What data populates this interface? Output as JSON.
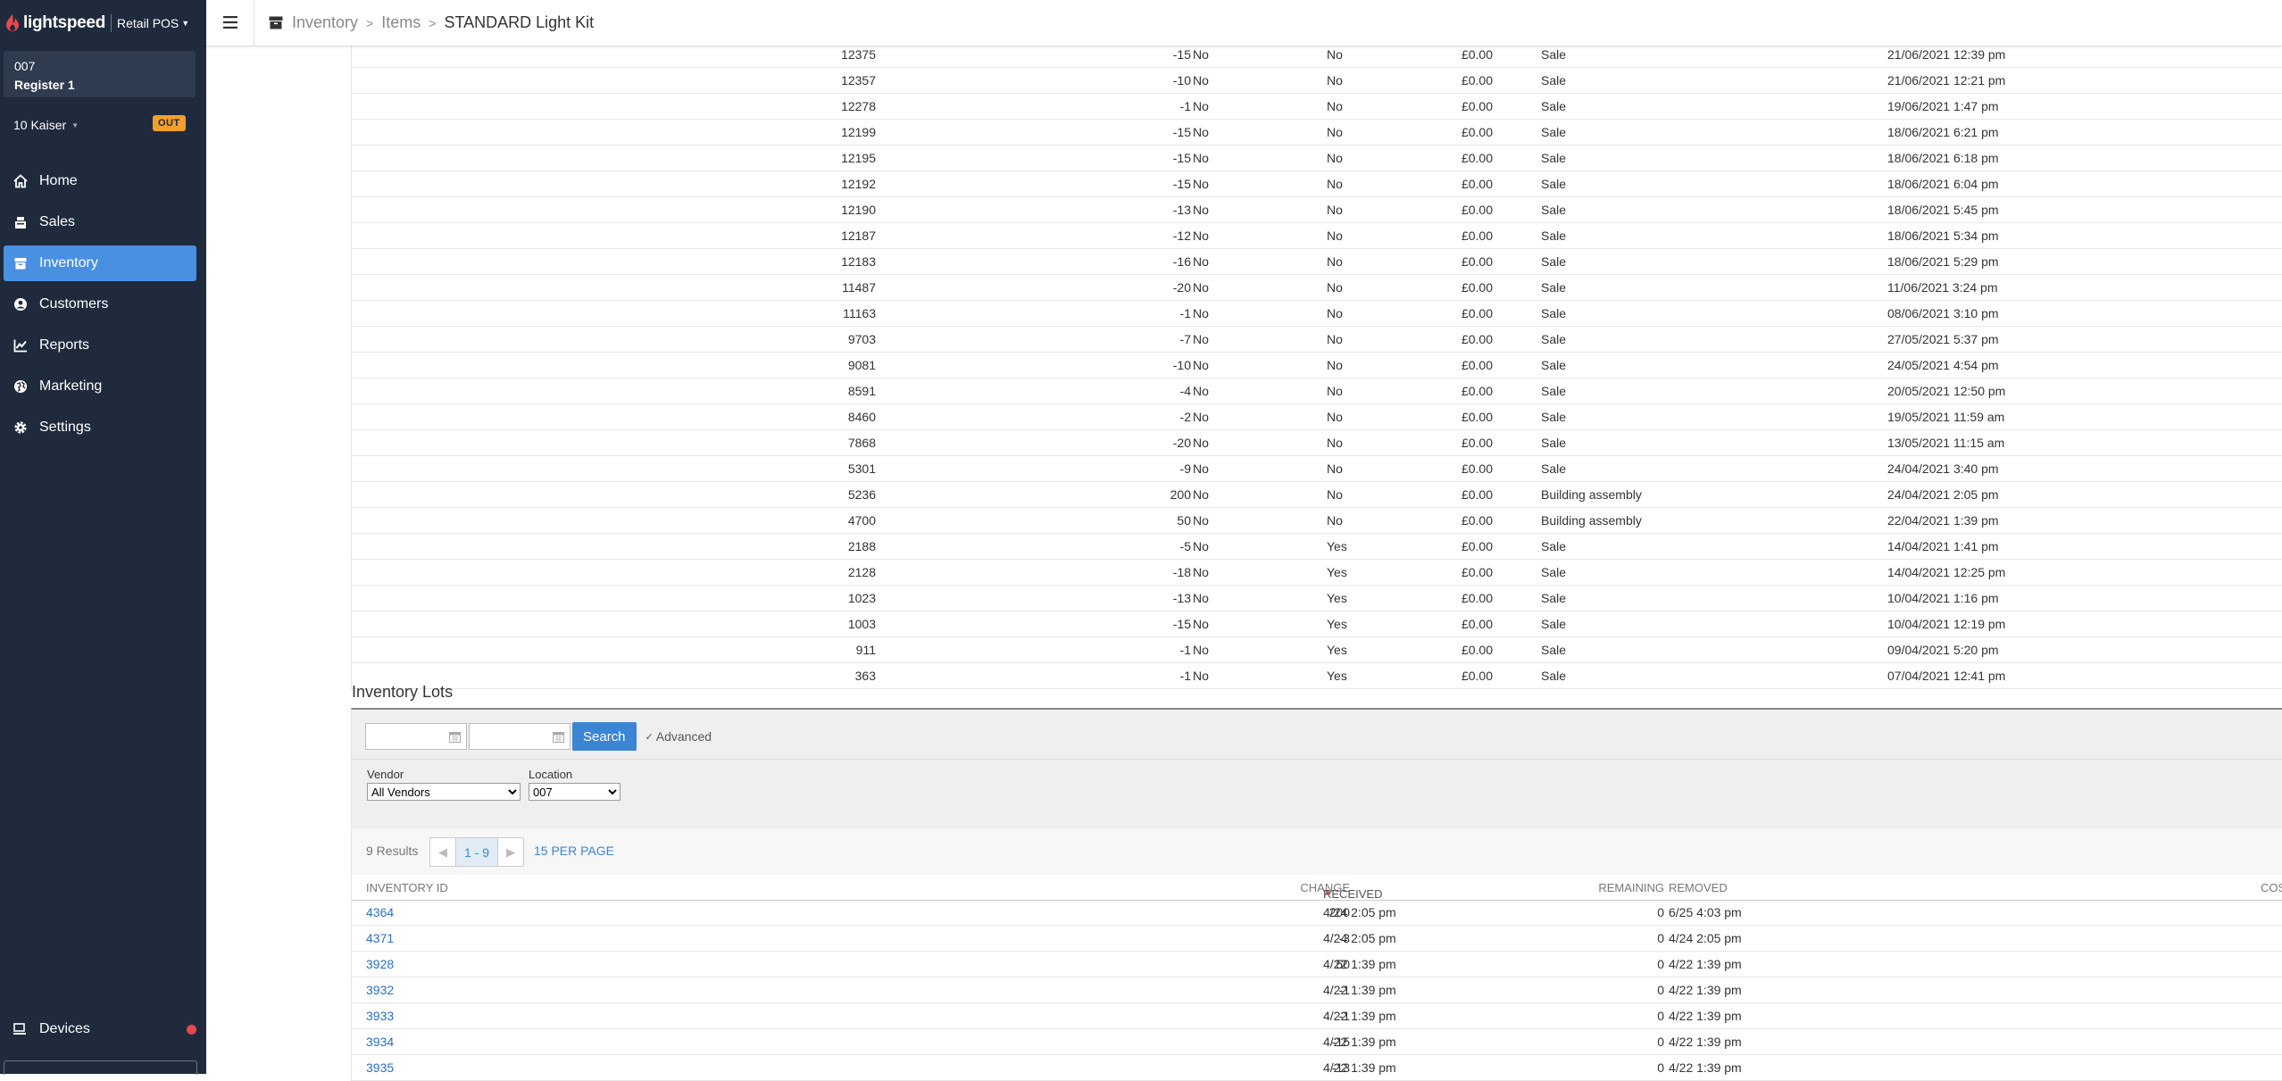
{
  "brand": {
    "name": "lightspeed",
    "product": "Retail POS"
  },
  "register": {
    "code": "007",
    "name": "Register 1"
  },
  "user": {
    "name": "10 Kaiser",
    "status_badge": "OUT"
  },
  "nav": [
    {
      "label": "Home",
      "icon": "home-icon"
    },
    {
      "label": "Sales",
      "icon": "sales-icon"
    },
    {
      "label": "Inventory",
      "icon": "inventory-icon",
      "active": true
    },
    {
      "label": "Customers",
      "icon": "customers-icon"
    },
    {
      "label": "Reports",
      "icon": "reports-icon"
    },
    {
      "label": "Marketing",
      "icon": "marketing-icon"
    },
    {
      "label": "Settings",
      "icon": "settings-icon"
    }
  ],
  "devices": {
    "label": "Devices"
  },
  "breadcrumb": {
    "items": [
      "Inventory",
      "Items",
      "STANDARD Light Kit"
    ]
  },
  "history": {
    "rows": [
      {
        "id": "12375",
        "change": "-15",
        "cost": "£0.00",
        "a": "No",
        "b": "No",
        "type": "Sale",
        "date": "21/06/2021 12:39 pm"
      },
      {
        "id": "12357",
        "change": "-10",
        "cost": "£0.00",
        "a": "No",
        "b": "No",
        "type": "Sale",
        "date": "21/06/2021 12:21 pm"
      },
      {
        "id": "12278",
        "change": "-1",
        "cost": "£0.00",
        "a": "No",
        "b": "No",
        "type": "Sale",
        "date": "19/06/2021 1:47 pm"
      },
      {
        "id": "12199",
        "change": "-15",
        "cost": "£0.00",
        "a": "No",
        "b": "No",
        "type": "Sale",
        "date": "18/06/2021 6:21 pm"
      },
      {
        "id": "12195",
        "change": "-15",
        "cost": "£0.00",
        "a": "No",
        "b": "No",
        "type": "Sale",
        "date": "18/06/2021 6:18 pm"
      },
      {
        "id": "12192",
        "change": "-15",
        "cost": "£0.00",
        "a": "No",
        "b": "No",
        "type": "Sale",
        "date": "18/06/2021 6:04 pm"
      },
      {
        "id": "12190",
        "change": "-13",
        "cost": "£0.00",
        "a": "No",
        "b": "No",
        "type": "Sale",
        "date": "18/06/2021 5:45 pm"
      },
      {
        "id": "12187",
        "change": "-12",
        "cost": "£0.00",
        "a": "No",
        "b": "No",
        "type": "Sale",
        "date": "18/06/2021 5:34 pm"
      },
      {
        "id": "12183",
        "change": "-16",
        "cost": "£0.00",
        "a": "No",
        "b": "No",
        "type": "Sale",
        "date": "18/06/2021 5:29 pm"
      },
      {
        "id": "11487",
        "change": "-20",
        "cost": "£0.00",
        "a": "No",
        "b": "No",
        "type": "Sale",
        "date": "11/06/2021 3:24 pm"
      },
      {
        "id": "11163",
        "change": "-1",
        "cost": "£0.00",
        "a": "No",
        "b": "No",
        "type": "Sale",
        "date": "08/06/2021 3:10 pm"
      },
      {
        "id": "9703",
        "change": "-7",
        "cost": "£0.00",
        "a": "No",
        "b": "No",
        "type": "Sale",
        "date": "27/05/2021 5:37 pm"
      },
      {
        "id": "9081",
        "change": "-10",
        "cost": "£0.00",
        "a": "No",
        "b": "No",
        "type": "Sale",
        "date": "24/05/2021 4:54 pm"
      },
      {
        "id": "8591",
        "change": "-4",
        "cost": "£0.00",
        "a": "No",
        "b": "No",
        "type": "Sale",
        "date": "20/05/2021 12:50 pm"
      },
      {
        "id": "8460",
        "change": "-2",
        "cost": "£0.00",
        "a": "No",
        "b": "No",
        "type": "Sale",
        "date": "19/05/2021 11:59 am"
      },
      {
        "id": "7868",
        "change": "-20",
        "cost": "£0.00",
        "a": "No",
        "b": "No",
        "type": "Sale",
        "date": "13/05/2021 11:15 am"
      },
      {
        "id": "5301",
        "change": "-9",
        "cost": "£0.00",
        "a": "No",
        "b": "No",
        "type": "Sale",
        "date": "24/04/2021 3:40 pm"
      },
      {
        "id": "5236",
        "change": "200",
        "cost": "£0.00",
        "a": "No",
        "b": "No",
        "type": "Building assembly",
        "date": "24/04/2021 2:05 pm"
      },
      {
        "id": "4700",
        "change": "50",
        "cost": "£0.00",
        "a": "No",
        "b": "No",
        "type": "Building assembly",
        "date": "22/04/2021 1:39 pm"
      },
      {
        "id": "2188",
        "change": "-5",
        "cost": "£0.00",
        "a": "No",
        "b": "Yes",
        "type": "Sale",
        "date": "14/04/2021 1:41 pm"
      },
      {
        "id": "2128",
        "change": "-18",
        "cost": "£0.00",
        "a": "No",
        "b": "Yes",
        "type": "Sale",
        "date": "14/04/2021 12:25 pm"
      },
      {
        "id": "1023",
        "change": "-13",
        "cost": "£0.00",
        "a": "No",
        "b": "Yes",
        "type": "Sale",
        "date": "10/04/2021 1:16 pm"
      },
      {
        "id": "1003",
        "change": "-15",
        "cost": "£0.00",
        "a": "No",
        "b": "Yes",
        "type": "Sale",
        "date": "10/04/2021 12:19 pm"
      },
      {
        "id": "911",
        "change": "-1",
        "cost": "£0.00",
        "a": "No",
        "b": "Yes",
        "type": "Sale",
        "date": "09/04/2021 5:20 pm"
      },
      {
        "id": "363",
        "change": "-1",
        "cost": "£0.00",
        "a": "No",
        "b": "Yes",
        "type": "Sale",
        "date": "07/04/2021 12:41 pm"
      }
    ]
  },
  "lots": {
    "title": "Inventory Lots",
    "search_label": "Search",
    "advanced_label": "Advanced",
    "vendor_label": "Vendor",
    "vendor_value": "All Vendors",
    "location_label": "Location",
    "location_value": "007",
    "results_text": "9 Results",
    "page_range": "1 - 9",
    "per_page": "15 PER PAGE",
    "headers": {
      "id": "INVENTORY ID",
      "change": "CHANGE",
      "remaining": "REMAINING",
      "received": "RECEIVED",
      "removed": "REMOVED",
      "cost": "COS"
    },
    "rows": [
      {
        "id": "4364",
        "change": "200",
        "remaining": "0",
        "received": "4/24 2:05 pm",
        "removed": "6/25 4:03 pm"
      },
      {
        "id": "4371",
        "change": "-3",
        "remaining": "0",
        "received": "4/24 2:05 pm",
        "removed": "4/24 2:05 pm"
      },
      {
        "id": "3928",
        "change": "50",
        "remaining": "0",
        "received": "4/22 1:39 pm",
        "removed": "4/22 1:39 pm"
      },
      {
        "id": "3932",
        "change": "-1",
        "remaining": "0",
        "received": "4/22 1:39 pm",
        "removed": "4/22 1:39 pm"
      },
      {
        "id": "3933",
        "change": "-1",
        "remaining": "0",
        "received": "4/22 1:39 pm",
        "removed": "4/22 1:39 pm"
      },
      {
        "id": "3934",
        "change": "-15",
        "remaining": "0",
        "received": "4/22 1:39 pm",
        "removed": "4/22 1:39 pm"
      },
      {
        "id": "3935",
        "change": "-13",
        "remaining": "0",
        "received": "4/22 1:39 pm",
        "removed": "4/22 1:39 pm"
      }
    ]
  },
  "colors": {
    "sidebar": "#1f2a3c",
    "accent": "#4a90e2",
    "badge": "#f0a02b",
    "link": "#2a6fbd",
    "alert": "#e5484d"
  }
}
